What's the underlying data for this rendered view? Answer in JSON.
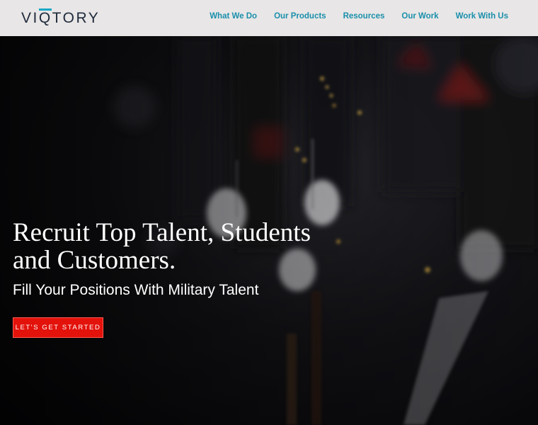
{
  "header": {
    "logo_text": "VIQTORY",
    "nav": [
      {
        "label": "What We Do"
      },
      {
        "label": "Our Products"
      },
      {
        "label": "Resources"
      },
      {
        "label": "Our Work"
      },
      {
        "label": "Work With Us"
      }
    ]
  },
  "hero": {
    "headline": "Recruit Top Talent, Students and Customers.",
    "subheadline": "Fill Your Positions With Military Talent",
    "cta_label": "LET'S GET STARTED",
    "background_image": "honor guard soldiers with rifles and white gloves"
  },
  "colors": {
    "nav_link": "#1a8fab",
    "logo_text": "#1f2a3c",
    "logo_accent": "#1aa7c6",
    "header_bg": "#e8e6e6",
    "cta_bg": "#e3120b"
  }
}
